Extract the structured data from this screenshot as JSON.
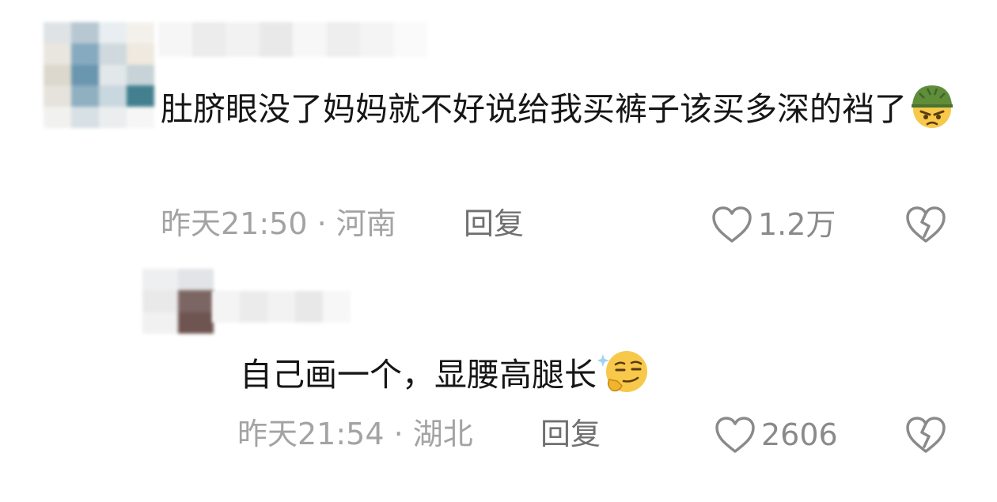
{
  "comments": [
    {
      "text": "肚脐眼没了妈妈就不好说给我买裤子该买多深的裆了",
      "emoji_icon": "angry-face-with-green-helmet-icon",
      "time_location": "昨天21:50 · 河南",
      "reply_label": "回复",
      "like_count": "1.2万"
    },
    {
      "text": "自己画一个，显腰高腿长",
      "emoji_icon": "smirking-thinking-face-icon",
      "time_location": "昨天21:54 · 湖北",
      "reply_label": "回复",
      "like_count": "2606"
    }
  ],
  "colors": {
    "text": "#161616",
    "meta": "#a3a3a3",
    "reply": "#707070",
    "icon": "#8a8a8a"
  }
}
